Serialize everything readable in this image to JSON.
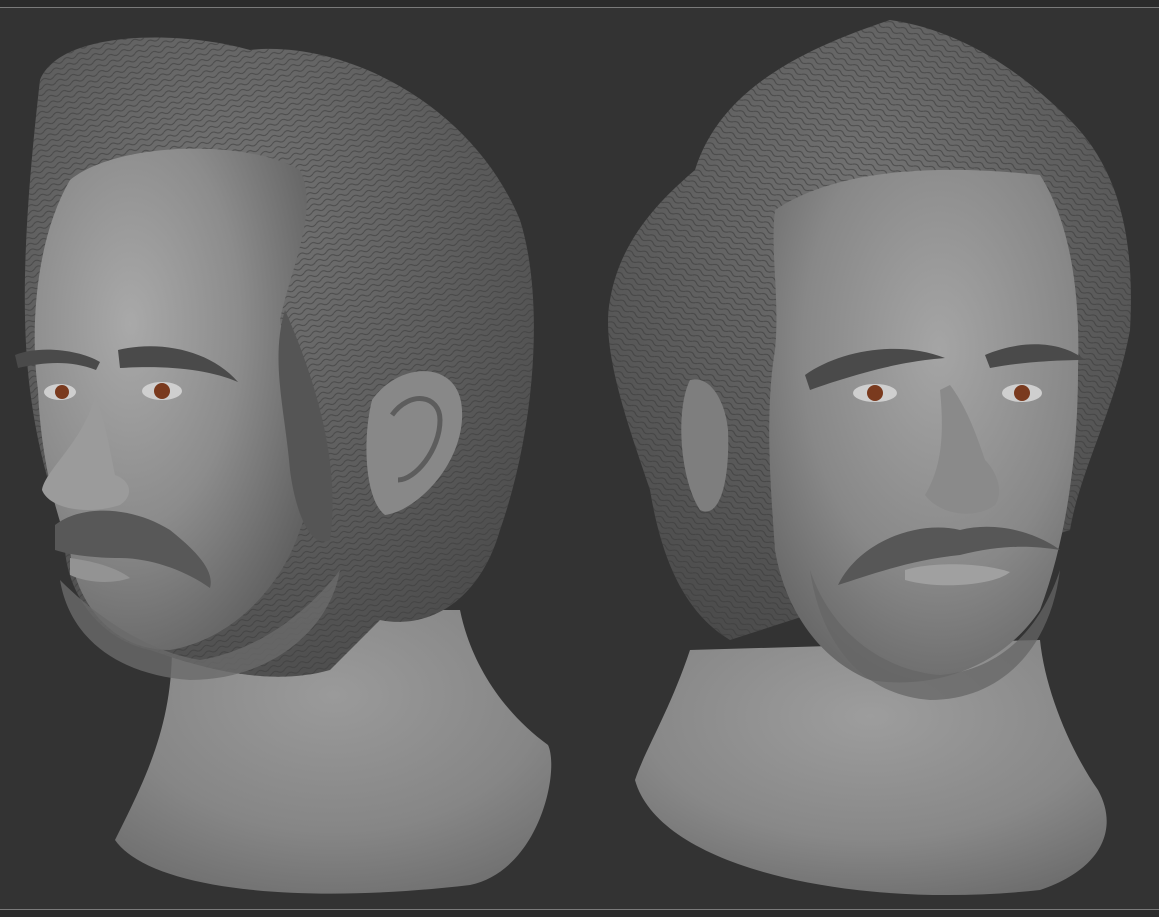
{
  "viewport": {
    "background_color": "#333333",
    "frame_line_color": "#7a7a7a"
  },
  "sculpts": [
    {
      "view": "three-quarter-left",
      "material_color": "#8a8a8a",
      "hair_color": "#5e5e5e",
      "iris_color": "#7a3a1e"
    },
    {
      "view": "three-quarter-right",
      "material_color": "#8a8a8a",
      "hair_color": "#5e5e5e",
      "iris_color": "#7a3a1e"
    }
  ]
}
